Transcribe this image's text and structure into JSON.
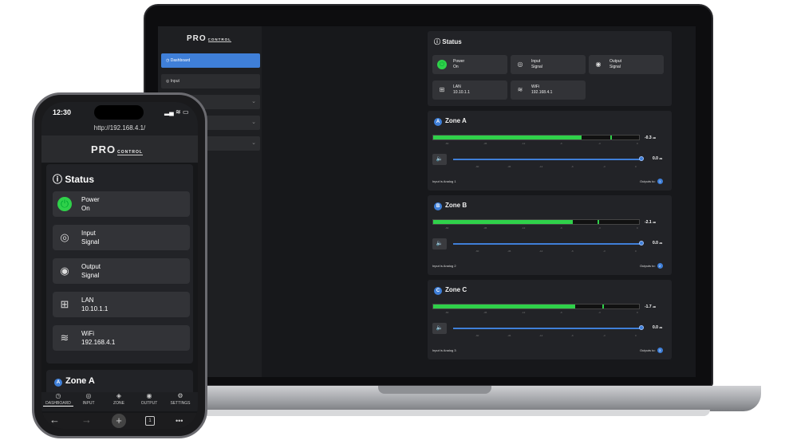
{
  "colors": {
    "accent": "#3f7fd8",
    "meter": "#2fd14a",
    "power_on": "#2fd14a"
  },
  "laptop": {
    "sidebar": {
      "logo": "PRO",
      "logo_sub": "CONTROL",
      "items": [
        {
          "label": "Dashboard",
          "icon": "gauge-icon",
          "active": true
        },
        {
          "label": "Input",
          "icon": "input-icon",
          "active": false
        },
        {
          "label": "",
          "icon": "",
          "active": false
        },
        {
          "label": "",
          "icon": "",
          "active": false
        },
        {
          "label": "",
          "icon": "",
          "active": false
        }
      ]
    },
    "status": {
      "title": "Status",
      "tiles": [
        {
          "label": "Power",
          "value": "On",
          "icon": "power-icon"
        },
        {
          "label": "Input",
          "value": "Signal",
          "icon": "input-signal-icon"
        },
        {
          "label": "Output",
          "value": "Signal",
          "icon": "output-signal-icon"
        },
        {
          "label": "LAN",
          "value": "10.10.1.1",
          "icon": "lan-icon"
        },
        {
          "label": "WiFi",
          "value": "192.168.4.1",
          "icon": "wifi-icon"
        }
      ]
    },
    "zones": [
      {
        "badge": "A",
        "title": "Zone A",
        "level": 0.72,
        "peak": 0.86,
        "db": "-0.3",
        "unit": "dB",
        "volume": 1.0,
        "volume_db": "0.0",
        "input_text": "Input is Analog 1",
        "outputs_label": "Outputs to:",
        "outputs": "1"
      },
      {
        "badge": "B",
        "title": "Zone B",
        "level": 0.68,
        "peak": 0.8,
        "db": "-2.1",
        "unit": "dB",
        "volume": 1.0,
        "volume_db": "0.0",
        "input_text": "Input is Analog 2",
        "outputs_label": "Outputs to:",
        "outputs": "2"
      },
      {
        "badge": "C",
        "title": "Zone C",
        "level": 0.69,
        "peak": 0.82,
        "db": "-1.7",
        "unit": "dB",
        "volume": 1.0,
        "volume_db": "0.0",
        "input_text": "Input is Analog 3",
        "outputs_label": "Outputs to:",
        "outputs": "3"
      }
    ],
    "meter_scale": [
      "-60",
      "-36",
      "-12",
      "-6",
      "-3",
      "0"
    ],
    "volume_scale": [
      "-60",
      "-36",
      "-12",
      "-6",
      "-3",
      "0"
    ]
  },
  "phone": {
    "time": "12:30",
    "url": "http://192.168.4.1/",
    "logo": "PRO",
    "logo_sub": "CONTROL",
    "status_title": "Status",
    "items": [
      {
        "label": "Power",
        "value": "On",
        "icon": "power-icon"
      },
      {
        "label": "Input",
        "value": "Signal",
        "icon": "input-signal-icon"
      },
      {
        "label": "Output",
        "value": "Signal",
        "icon": "output-signal-icon"
      },
      {
        "label": "LAN",
        "value": "10.10.1.1",
        "icon": "lan-icon"
      },
      {
        "label": "WiFi",
        "value": "192.168.4.1",
        "icon": "wifi-icon"
      }
    ],
    "zone_badge": "A",
    "zone_title": "Zone A",
    "tabs": [
      {
        "label": "DASHBOARD",
        "icon": "gauge-icon"
      },
      {
        "label": "INPUT",
        "icon": "input-icon"
      },
      {
        "label": "ZONE",
        "icon": "zone-icon"
      },
      {
        "label": "OUTPUT",
        "icon": "output-icon"
      },
      {
        "label": "SETTINGS",
        "icon": "gear-icon"
      }
    ],
    "browser": {
      "back": "←",
      "forward": "→",
      "new_tab": "+",
      "tabs": "1",
      "more": "•••"
    }
  }
}
